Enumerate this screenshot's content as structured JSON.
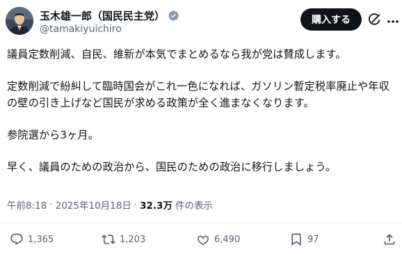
{
  "author": {
    "display_name": "玉木雄一郎（国民民主党）",
    "handle": "@tamakiyuichiro"
  },
  "header": {
    "buy_label": "購入する"
  },
  "post": {
    "paragraphs": [
      "議員定数削減、自民、維新が本気でまとめるなら我が党は賛成します。",
      "定数削減で紛糾して臨時国会がこれ一色になれば、ガソリン暫定税率廃止や年収の壁の引き上げなど国民が求める政策が全く進まなくなります。",
      "参院選から3ヶ月。",
      "早く、議員のための政治から、国民のための政治に移行しましょう。"
    ],
    "time": "午前8:18",
    "separator": "·",
    "date": "2025年10月18日",
    "views_count": "32.3万",
    "views_label": "件の表示"
  },
  "actions": {
    "replies": "1,365",
    "reposts": "1,203",
    "likes": "6,490",
    "bookmarks": "97"
  },
  "colors": {
    "verified": "#829aab",
    "muted": "#536471",
    "text": "#0f1419"
  },
  "icons": [
    "verified-icon",
    "grok-icon",
    "more-icon",
    "reply-icon",
    "repost-icon",
    "like-icon",
    "bookmark-icon",
    "share-icon"
  ]
}
